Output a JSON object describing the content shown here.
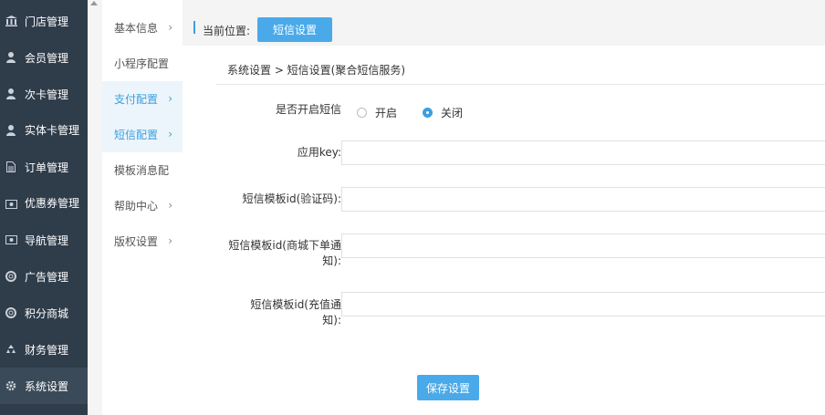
{
  "sidebar": {
    "items": [
      {
        "label": "门店管理",
        "icon": "bank-icon"
      },
      {
        "label": "会员管理",
        "icon": "user-icon"
      },
      {
        "label": "次卡管理",
        "icon": "user-icon"
      },
      {
        "label": "实体卡管理",
        "icon": "user-icon"
      },
      {
        "label": "订单管理",
        "icon": "document-icon"
      },
      {
        "label": "优惠券管理",
        "icon": "ticket-icon"
      },
      {
        "label": "导航管理",
        "icon": "ticket-icon"
      },
      {
        "label": "广告管理",
        "icon": "lifebuoy-icon"
      },
      {
        "label": "积分商城",
        "icon": "lifebuoy-icon"
      },
      {
        "label": "财务管理",
        "icon": "recycle-icon"
      },
      {
        "label": "系统设置",
        "icon": "gear-icon"
      }
    ]
  },
  "submenu": {
    "items": [
      {
        "label": "基本信息"
      },
      {
        "label": "小程序配置"
      },
      {
        "label": "支付配置"
      },
      {
        "label": "短信配置"
      },
      {
        "label": "模板消息配"
      },
      {
        "label": "帮助中心"
      },
      {
        "label": "版权设置"
      }
    ]
  },
  "location": {
    "label": "当前位置:",
    "current": "短信设置"
  },
  "breadcrumb": "系统设置 > 短信设置(聚合短信服务)",
  "form": {
    "enable_label": "是否开启短信",
    "radio_on": "开启",
    "radio_off": "关闭",
    "selected": "关闭",
    "key_label": "应用key:",
    "key_value": "",
    "tpl_verify_label": "短信模板id(验证码):",
    "tpl_verify_value": "",
    "tpl_order_label_1": "短信模板id(商城下单通",
    "tpl_order_label_2": "知):",
    "tpl_order_value": "",
    "tpl_recharge_label_1": "短信模板id(充值通",
    "tpl_recharge_label_2": "知):",
    "tpl_recharge_value": "",
    "save_label": "保存设置"
  },
  "colors": {
    "sidebar_bg": "#2f3c4a",
    "accent": "#4aa9e9"
  }
}
